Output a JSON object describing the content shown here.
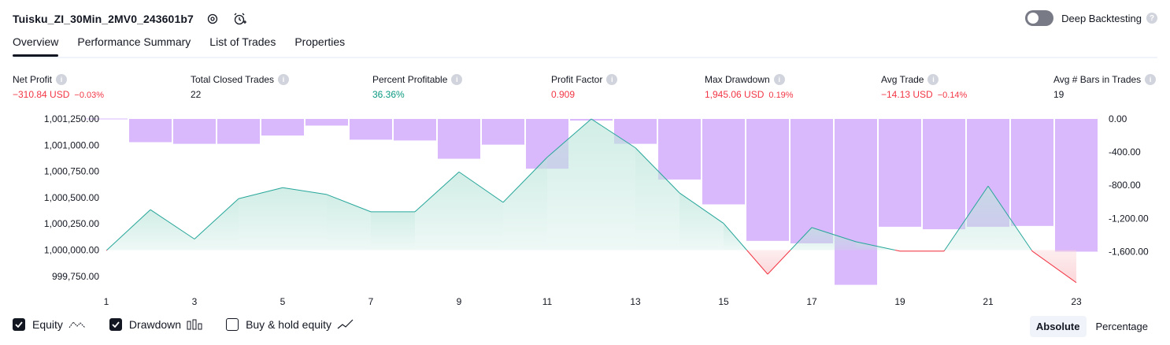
{
  "header": {
    "title": "Tuisku_ZI_30Min_2MV0_243601b7",
    "deep_backtesting_label": "Deep Backtesting"
  },
  "tabs": [
    {
      "label": "Overview",
      "active": true
    },
    {
      "label": "Performance Summary"
    },
    {
      "label": "List of Trades"
    },
    {
      "label": "Properties"
    }
  ],
  "metrics": {
    "net_profit": {
      "label": "Net Profit",
      "value": "−310.84 USD",
      "pct": "−0.03%"
    },
    "total_closed_trades": {
      "label": "Total Closed Trades",
      "value": "22"
    },
    "percent_profitable": {
      "label": "Percent Profitable",
      "value": "36.36%"
    },
    "profit_factor": {
      "label": "Profit Factor",
      "value": "0.909"
    },
    "max_drawdown": {
      "label": "Max Drawdown",
      "value": "1,945.06 USD",
      "pct": "0.19%"
    },
    "avg_trade": {
      "label": "Avg Trade",
      "value": "−14.13 USD",
      "pct": "−0.14%"
    },
    "avg_bars": {
      "label": "Avg # Bars in Trades",
      "value": "19"
    }
  },
  "chart_data": {
    "type": "line",
    "x": [
      1,
      2,
      3,
      4,
      5,
      6,
      7,
      8,
      9,
      10,
      11,
      12,
      13,
      14,
      15,
      16,
      17,
      18,
      19,
      20,
      21,
      22,
      23
    ],
    "x_tick_labels": [
      "1",
      "3",
      "5",
      "7",
      "9",
      "11",
      "13",
      "15",
      "17",
      "19",
      "21",
      "23"
    ],
    "equity": [
      999995,
      1000385,
      1000105,
      1000490,
      1000595,
      1000530,
      1000365,
      1000365,
      1000745,
      1000455,
      1000885,
      1001250,
      1000975,
      1000545,
      1000255,
      999770,
      1000215,
      1000080,
      999990,
      999990,
      1000610,
      999990,
      999690
    ],
    "drawdown": [
      0,
      -280,
      -300,
      -300,
      -200,
      -80,
      -250,
      -260,
      -480,
      -310,
      -600,
      -20,
      -300,
      -730,
      -1030,
      -1470,
      -1500,
      -2000,
      -1300,
      -1330,
      -1300,
      -1290,
      -1600
    ],
    "left_axis_labels": [
      "1,001,250.00",
      "1,001,000.00",
      "1,000,750.00",
      "1,000,500.00",
      "1,000,250.00",
      "1,000,000.00",
      "999,750.00"
    ],
    "left_axis_values": [
      1001250,
      1001000,
      1000750,
      1000500,
      1000250,
      1000000,
      999750
    ],
    "right_axis_labels": [
      "0.00",
      "-400.00",
      "-800.00",
      "-1,200.00",
      "-1,600.00"
    ],
    "right_axis_values": [
      0,
      -400,
      -800,
      -1200,
      -1600
    ],
    "baseline": 1000000,
    "colors": {
      "equity_line": "#26a69a",
      "equity_fill": "#bfe6dc",
      "negative_line": "#f23645",
      "negative_fill": "#fbd5d8",
      "drawdown_bar": "#d9b8fb"
    }
  },
  "footer": {
    "equity_label": "Equity",
    "drawdown_label": "Drawdown",
    "buyhold_label": "Buy & hold equity",
    "mode_absolute": "Absolute",
    "mode_percentage": "Percentage"
  }
}
